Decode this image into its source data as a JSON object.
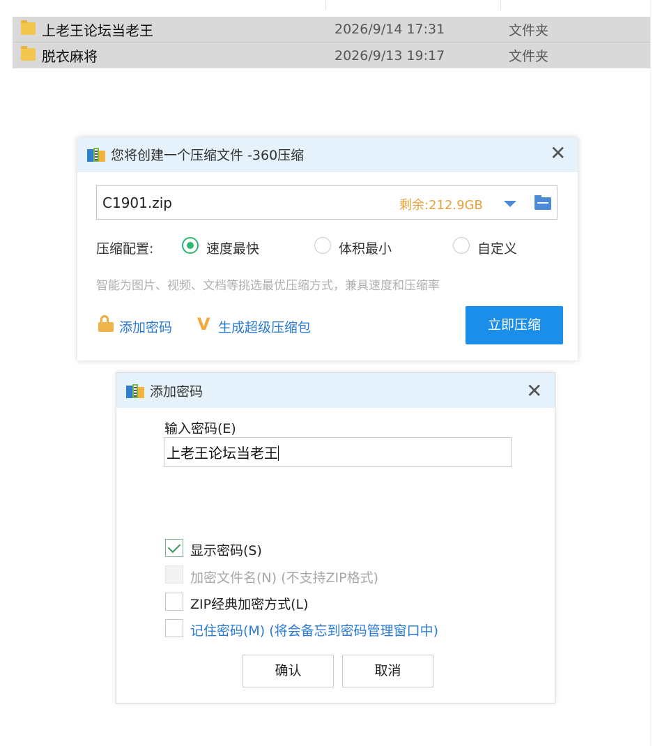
{
  "explorer": {
    "rows": [
      {
        "name": "上老王论坛当老王",
        "date": "2026/9/14 17:31",
        "type": "文件夹",
        "icon": "folder-icon"
      },
      {
        "name": "脱衣麻将",
        "date": "2026/9/13 19:17",
        "type": "文件夹",
        "icon": "folder-icon"
      }
    ]
  },
  "compress_dialog": {
    "title": "您将创建一个压缩文件 -360压缩",
    "close": "✕",
    "path_value": "C1901.zip",
    "free_space": "剩余:212.9GB",
    "config_label": "压缩配置:",
    "options": [
      {
        "label": "速度最快",
        "selected": true
      },
      {
        "label": "体积最小",
        "selected": false
      },
      {
        "label": "自定义",
        "selected": false
      }
    ],
    "hint": "智能为图片、视频、文档等挑选最优压缩方式，兼具速度和压缩率",
    "add_password_link": "添加密码",
    "super_pack_icon": "V",
    "super_pack_link": "生成超级压缩包",
    "compress_button": "立即压缩",
    "accent_color": "#1a8ee9"
  },
  "password_dialog": {
    "title": "添加密码",
    "close": "✕",
    "input_label": "输入密码(E)",
    "input_value": "上老王论坛当老王",
    "checkboxes": [
      {
        "label": "显示密码(S)",
        "checked": true,
        "disabled": false
      },
      {
        "label": "加密文件名(N) (不支持ZIP格式)",
        "checked": false,
        "disabled": true
      },
      {
        "label": "ZIP经典加密方式(L)",
        "checked": false,
        "disabled": false
      },
      {
        "label": "记住密码(M) (将会备忘到密码管理窗口中)",
        "checked": false,
        "disabled": false
      }
    ],
    "confirm_button": "确认",
    "cancel_button": "取消"
  }
}
